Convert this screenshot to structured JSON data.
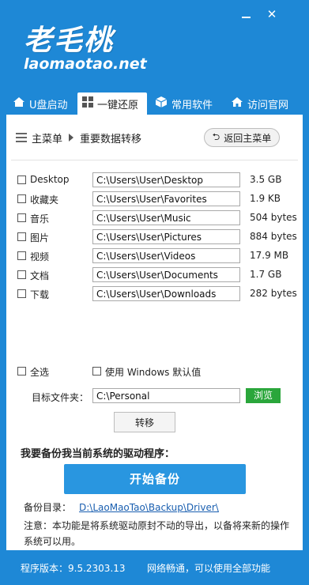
{
  "app": {
    "logo_cn": "老毛桃",
    "logo_en": "laomaotao.net"
  },
  "tabs": [
    {
      "label": "U盘启动",
      "icon": "house-icon"
    },
    {
      "label": "一键还原",
      "icon": "windows-icon"
    },
    {
      "label": "常用软件",
      "icon": "box-icon"
    },
    {
      "label": "访问官网",
      "icon": "home-icon"
    }
  ],
  "breadcrumb": {
    "main": "主菜单",
    "current": "重要数据转移"
  },
  "back_button": "返回主菜单",
  "folders": [
    {
      "label": "Desktop",
      "path": "C:\\Users\\User\\Desktop",
      "size": "3.5 GB"
    },
    {
      "label": "收藏夹",
      "path": "C:\\Users\\User\\Favorites",
      "size": "1.9 KB"
    },
    {
      "label": "音乐",
      "path": "C:\\Users\\User\\Music",
      "size": "504 bytes"
    },
    {
      "label": "图片",
      "path": "C:\\Users\\User\\Pictures",
      "size": "884 bytes"
    },
    {
      "label": "视频",
      "path": "C:\\Users\\User\\Videos",
      "size": "17.9 MB"
    },
    {
      "label": "文档",
      "path": "C:\\Users\\User\\Documents",
      "size": "1.7 GB"
    },
    {
      "label": "下载",
      "path": "C:\\Users\\User\\Downloads",
      "size": "282 bytes"
    }
  ],
  "options": {
    "select_all": "全选",
    "use_default": "使用 Windows 默认值"
  },
  "target": {
    "label": "目标文件夹：",
    "value": "C:\\Personal",
    "browse": "浏览"
  },
  "transfer_button": "转移",
  "driver": {
    "title": "我要备份我当前系统的驱动程序：",
    "start_button": "开始备份",
    "dir_label": "备份目录：",
    "dir_link": "D:\\LaoMaoTao\\Backup\\Driver\\",
    "note": "注意：本功能是将系统驱动原封不动的导出，以备将来新的操作系统可以用。"
  },
  "status": {
    "version": "程序版本：9.5.2303.13",
    "network": "网络畅通，可以使用全部功能"
  }
}
